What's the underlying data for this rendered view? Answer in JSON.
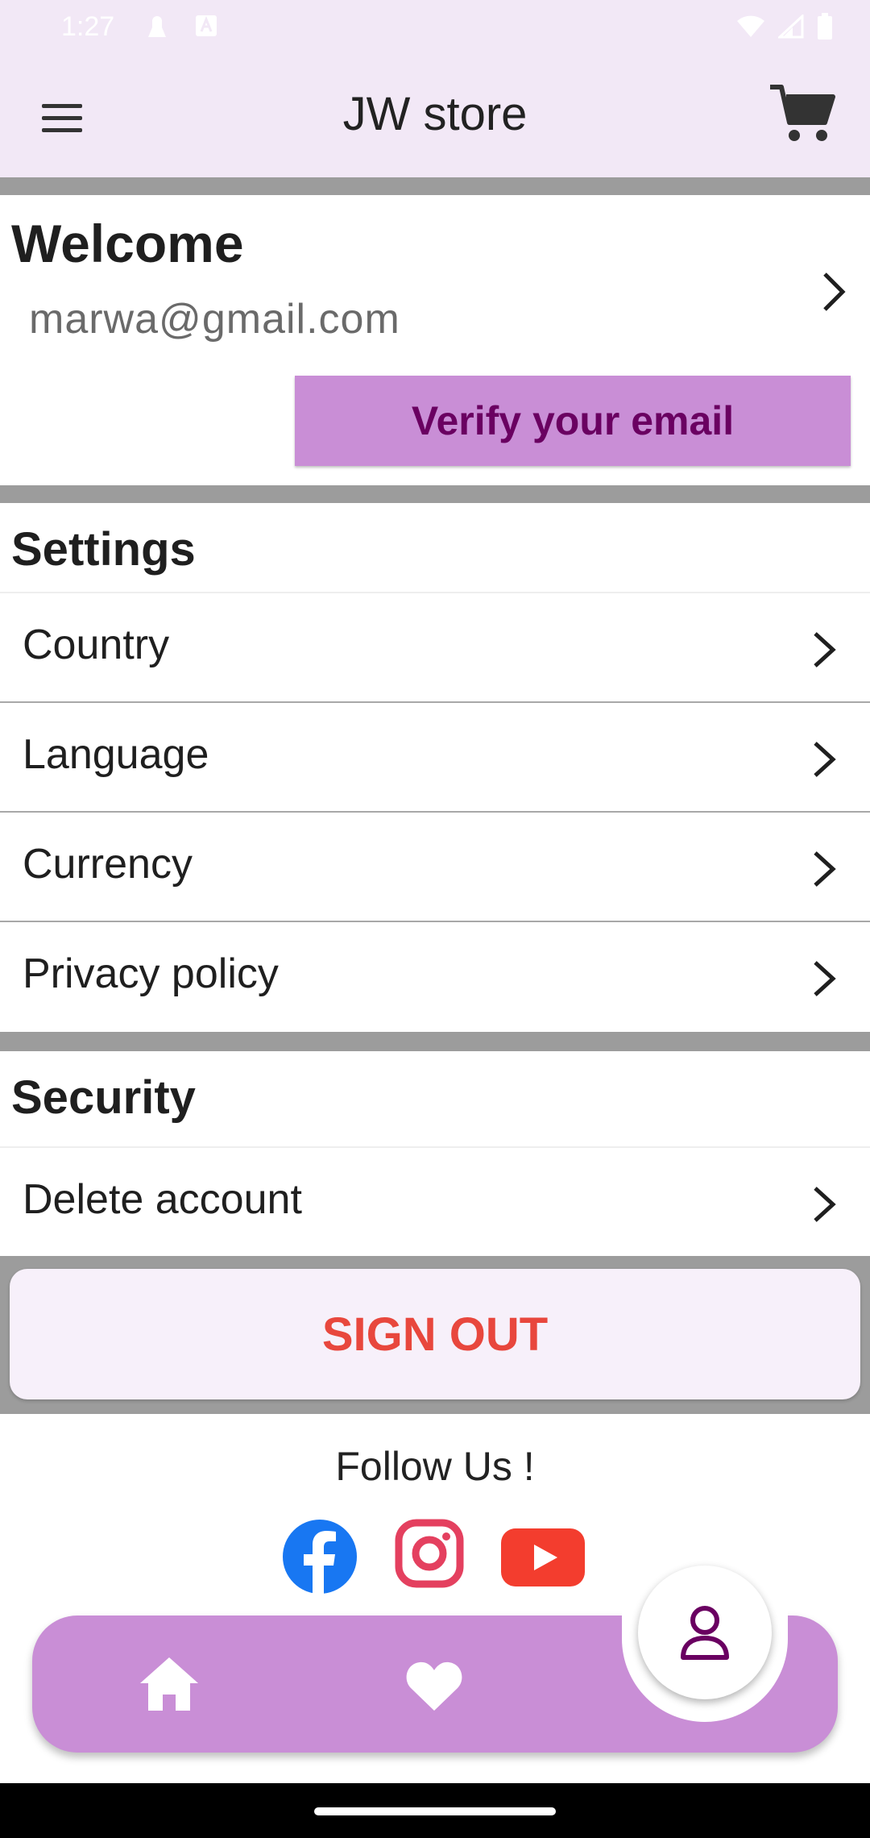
{
  "status_bar": {
    "time": "1:27"
  },
  "app_bar": {
    "title": "JW store"
  },
  "welcome": {
    "title": "Welcome",
    "email": "marwa@gmail.com",
    "verify_label": "Verify your email"
  },
  "settings": {
    "heading": "Settings",
    "items": [
      {
        "label": "Country"
      },
      {
        "label": "Language"
      },
      {
        "label": "Currency"
      },
      {
        "label": "Privacy policy"
      }
    ]
  },
  "security": {
    "heading": "Security",
    "items": [
      {
        "label": "Delete account"
      }
    ]
  },
  "sign_out": {
    "label": "SIGN OUT"
  },
  "follow": {
    "heading": "Follow Us !",
    "icons": [
      "facebook-icon",
      "instagram-icon",
      "youtube-icon"
    ]
  },
  "bottom_nav": {
    "items": [
      "home-icon",
      "heart-icon",
      "person-icon"
    ],
    "active": "person-icon"
  },
  "colors": {
    "accent": "#c98ed6",
    "verify_text": "#6a0061",
    "sign_out_text": "#e8473d",
    "app_bar_bg": "#f2e8f6",
    "divider": "#9c9c9c"
  }
}
